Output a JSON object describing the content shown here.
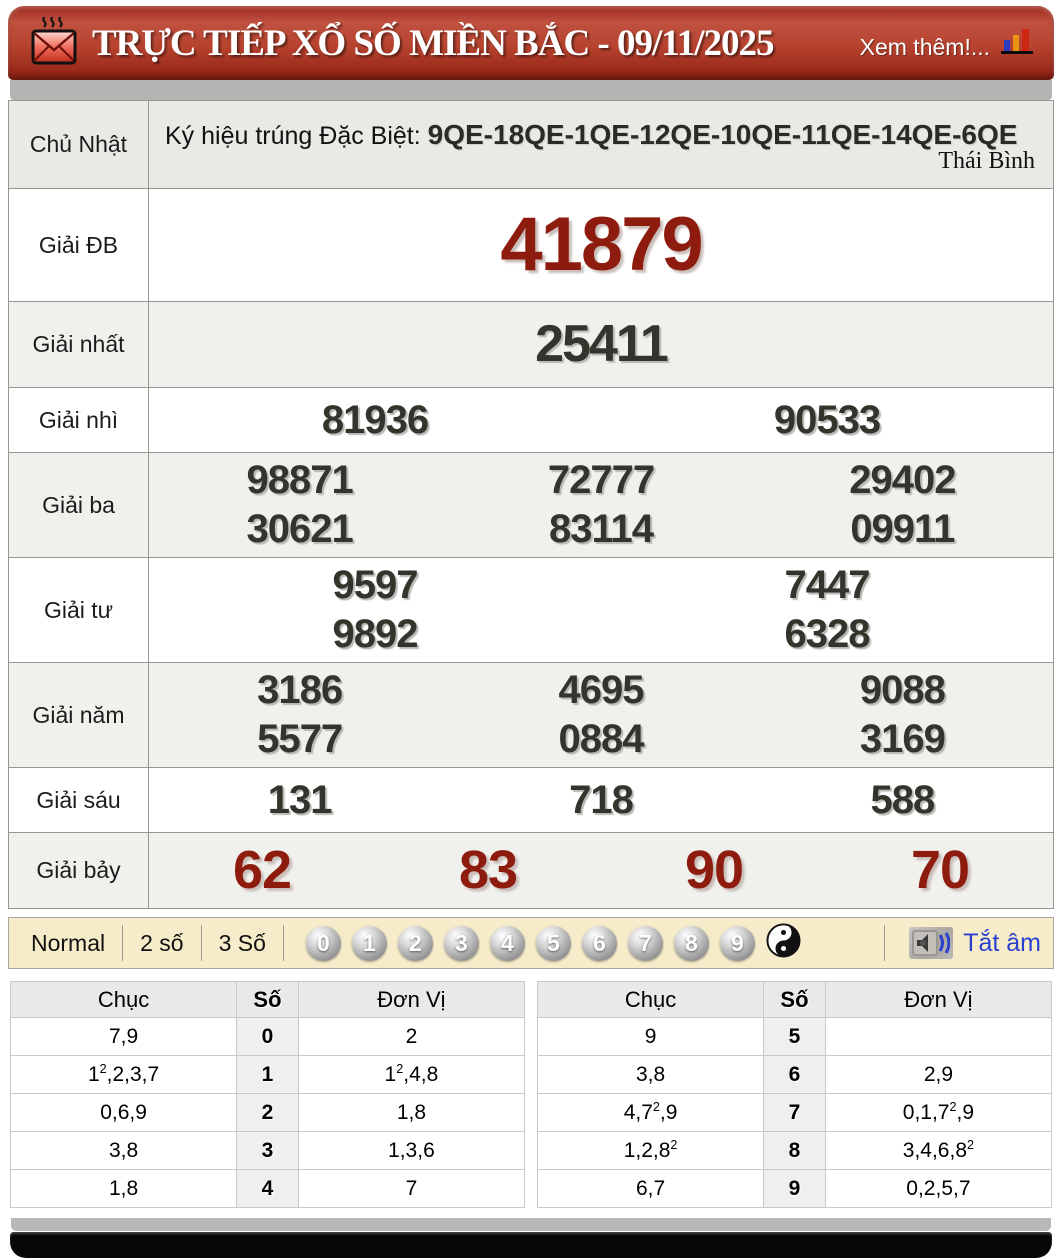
{
  "header": {
    "title": "TRỰC TIẾP XỔ SỐ MIỀN BẮC - 09/11/2025",
    "more_link": "Xem thêm!..."
  },
  "info_row": {
    "day": "Chủ Nhật",
    "sign_label": "Ký hiệu trúng Đặc Biệt: ",
    "sign_codes": "9QE-18QE-1QE-12QE-10QE-11QE-14QE-6QE",
    "province": "Thái Bình"
  },
  "prizes": [
    {
      "id": "db",
      "label": "Giải ĐB",
      "lines": [
        [
          "41879"
        ]
      ]
    },
    {
      "id": "nhat",
      "label": "Giải nhất",
      "lines": [
        [
          "25411"
        ]
      ]
    },
    {
      "id": "nhi",
      "label": "Giải nhì",
      "lines": [
        [
          "81936",
          "90533"
        ]
      ]
    },
    {
      "id": "ba",
      "label": "Giải ba",
      "lines": [
        [
          "98871",
          "72777",
          "29402"
        ],
        [
          "30621",
          "83114",
          "09911"
        ]
      ]
    },
    {
      "id": "tu",
      "label": "Giải tư",
      "lines": [
        [
          "9597",
          "7447"
        ],
        [
          "9892",
          "6328"
        ]
      ]
    },
    {
      "id": "nam",
      "label": "Giải năm",
      "lines": [
        [
          "3186",
          "4695",
          "9088"
        ],
        [
          "5577",
          "0884",
          "3169"
        ]
      ]
    },
    {
      "id": "sau",
      "label": "Giải sáu",
      "lines": [
        [
          "131",
          "718",
          "588"
        ]
      ]
    },
    {
      "id": "bay",
      "label": "Giải bảy",
      "lines": [
        [
          "62",
          "83",
          "90",
          "70"
        ]
      ]
    }
  ],
  "toolbar": {
    "modes": [
      "Normal",
      "2 số",
      "3 Số"
    ],
    "digits": [
      "0",
      "1",
      "2",
      "3",
      "4",
      "5",
      "6",
      "7",
      "8",
      "9"
    ],
    "mute_label": "Tắt âm"
  },
  "stats": {
    "headers": [
      "Chục",
      "Số",
      "Đơn Vị"
    ],
    "left_rows": [
      [
        "7,9",
        "0",
        "2"
      ],
      [
        "1²,2,3,7",
        "1",
        "1²,4,8"
      ],
      [
        "0,6,9",
        "2",
        "1,8"
      ],
      [
        "3,8",
        "3",
        "1,3,6"
      ],
      [
        "1,8",
        "4",
        "7"
      ]
    ],
    "right_rows": [
      [
        "9",
        "5",
        ""
      ],
      [
        "3,8",
        "6",
        "2,9"
      ],
      [
        "4,7²,9",
        "7",
        "0,1,7²,9"
      ],
      [
        "1,2,8²",
        "8",
        "3,4,6,8²"
      ],
      [
        "6,7",
        "9",
        "0,2,5,7"
      ]
    ]
  },
  "colors": {
    "header_red": "#b7432f",
    "special_number_red": "#8e1c0e",
    "number_dark": "#35342c",
    "toolbar_cream": "#f6ecca",
    "link_blue": "#2940cf",
    "row_alt_gray": "#f0f0ed"
  }
}
